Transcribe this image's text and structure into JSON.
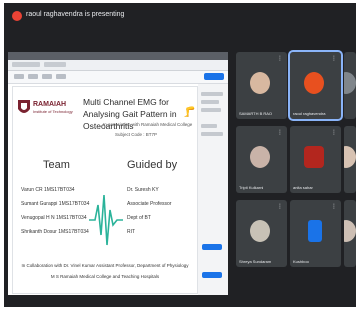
{
  "meeting": {
    "presenter_banner": "raoul raghavendra is presenting"
  },
  "slide": {
    "logo_name": "RAMAIAH",
    "logo_sub": "Institute of Technology",
    "title": "Multi Channel EMG for Analysing Gait Pattern in Osteoarthritis",
    "association": "In association with Ramaiah Medical College",
    "subject_code": "Subject Code : BT7P",
    "team_heading": "Team",
    "guided_heading": "Guided by",
    "members": [
      "Varun CR 1MS17BT034",
      "Sumant Gurappi 1MS17BT034",
      "Venugopal H N 1MS17BT034",
      "Shrikanth Dosur 1MS17BT034"
    ],
    "guide": [
      "Dr. Suresh KY",
      "Associate Professor",
      "Dept of BT",
      "RIT"
    ],
    "collab_line1": "In Collaboration with Dr. Vinel Kumar Assistant Professor, Department of Physiology",
    "collab_line2": "M S Ramaiah Medical College and Teaching Hospitals"
  },
  "participants": [
    {
      "name": "SAMARTH B RAO",
      "avatar_color": "#d8b8a0",
      "active": false
    },
    {
      "name": "raoul raghavendra",
      "avatar_color": "#e8501f",
      "active": true
    },
    {
      "name": "venu gopal",
      "avatar_color": "#80868b",
      "active": false
    },
    {
      "name": "Tripti Kulkarni",
      "avatar_color": "#c9b3a8",
      "active": false
    },
    {
      "name": "anita sahar",
      "avatar_color": "#b3261e",
      "active": false
    },
    {
      "name": "Priyanka Subhash",
      "avatar_color": "#d7c2b2",
      "active": false
    },
    {
      "name": "Shreya Sundaram",
      "avatar_color": "#c8c2b6",
      "active": false
    },
    {
      "name": "Kushboo",
      "avatar_color": "#1a73e8",
      "active": false
    },
    {
      "name": "You",
      "avatar_color": "#cdbfb4",
      "active": false
    }
  ]
}
